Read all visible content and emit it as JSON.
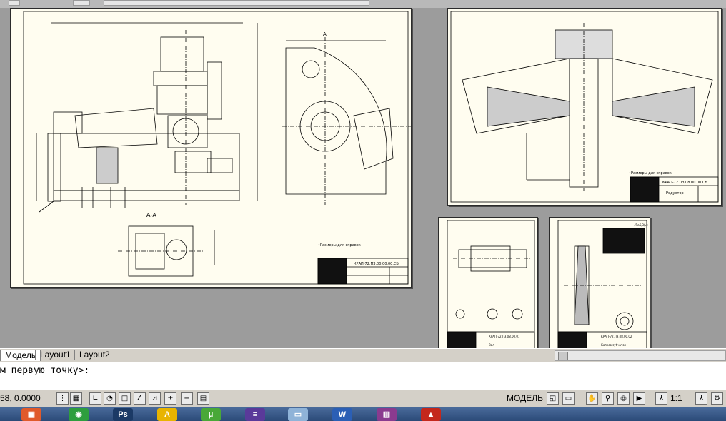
{
  "tabs": [
    {
      "label": "Модель",
      "active": true
    },
    {
      "label": "Layout1",
      "active": false
    },
    {
      "label": "Layout2",
      "active": false
    }
  ],
  "command_line": {
    "prompt": "м первую точку>: "
  },
  "status": {
    "coordinates": "58, 0.0000",
    "model_label": "МОДЕЛЬ",
    "annotation_scale": "1:1"
  },
  "drawing": {
    "section_label": "А-А",
    "view_label": "А",
    "note_text": "•Размеры для справок",
    "note_text_right": "•Размеры для справок",
    "tb_main_code": "КРАП-72.ПЗ.00.00.00.СБ",
    "tb_right_code": "КРАП-72.ПЗ.08.00.00.СБ",
    "tb_right_name": "Редуктор",
    "tb_small1_code": "КРАП-72.ПЗ.08.00.01",
    "tb_small1_name": "Вал",
    "tb_small2_code": "КРАП-72.ПЗ.08.00.02",
    "tb_small2_name": "Колесо зубчатое",
    "roughness": "√Ra6,3(√)"
  },
  "taskbar": {
    "apps": [
      "explorer",
      "chrome",
      "photoshop",
      "autocad",
      "utorrent",
      "visual-studio",
      "files",
      "word",
      "archive",
      "acrobat"
    ]
  },
  "colors": {
    "sheet_bg": "#fffdf0",
    "workspace_bg": "#9c9c9c",
    "ui_gray": "#d4d0c8"
  }
}
